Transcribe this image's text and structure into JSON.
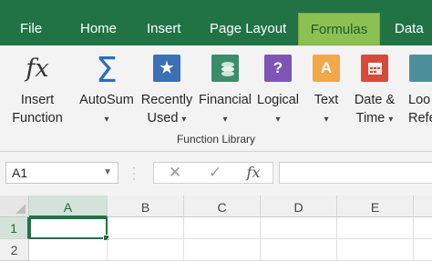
{
  "tabs": [
    {
      "label": "File"
    },
    {
      "label": "Home"
    },
    {
      "label": "Insert"
    },
    {
      "label": "Page Layout"
    },
    {
      "label": "Formulas",
      "active": true
    },
    {
      "label": "Data"
    }
  ],
  "ribbon": {
    "insert_function": {
      "line1": "Insert",
      "line2": "Function",
      "icon": "fx-icon"
    },
    "autosum": {
      "line1": "AutoSum",
      "icon": "sigma-icon"
    },
    "recently_used": {
      "line1": "Recently",
      "line2": "Used",
      "icon": "star-book-icon"
    },
    "financial": {
      "line1": "Financial",
      "icon": "coins-book-icon"
    },
    "logical": {
      "line1": "Logical",
      "icon": "question-book-icon",
      "glyph": "?"
    },
    "text": {
      "line1": "Text",
      "icon": "text-book-icon",
      "glyph": "A"
    },
    "date_time": {
      "line1": "Date &",
      "line2": "Time",
      "icon": "calendar-book-icon"
    },
    "lookup": {
      "line1": "Loo",
      "line2": "Refer",
      "icon": "lookup-book-icon"
    },
    "group_label": "Function Library"
  },
  "formula_bar": {
    "name_box": "A1",
    "cancel_glyph": "✕",
    "enter_glyph": "✓",
    "fx_glyph": "fx",
    "formula": ""
  },
  "grid": {
    "columns": [
      "A",
      "B",
      "C",
      "D",
      "E"
    ],
    "rows": [
      "1",
      "2"
    ],
    "active_cell": "A1"
  },
  "colors": {
    "tab_bar": "#217346",
    "active_tab": "#8cc152",
    "ribbon_bg": "#f3f3f3"
  }
}
